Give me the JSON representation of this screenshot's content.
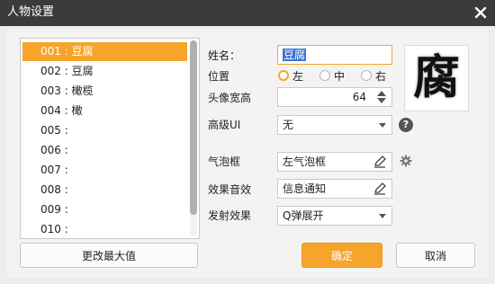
{
  "window": {
    "title": "人物设置"
  },
  "character_list": {
    "items": [
      {
        "label": "001 : 豆腐",
        "selected": true
      },
      {
        "label": "002 : 豆腐",
        "selected": false
      },
      {
        "label": "003 : 橄榄",
        "selected": false
      },
      {
        "label": "004 : 橄",
        "selected": false
      },
      {
        "label": "005 :",
        "selected": false
      },
      {
        "label": "006 :",
        "selected": false
      },
      {
        "label": "007 :",
        "selected": false
      },
      {
        "label": "008 :",
        "selected": false
      },
      {
        "label": "009 :",
        "selected": false
      },
      {
        "label": "010 :",
        "selected": false
      }
    ]
  },
  "buttons": {
    "change_max": "更改最大值",
    "ok": "确定",
    "cancel": "取消"
  },
  "form": {
    "name_label": "姓名：",
    "name_value": "豆腐",
    "position_label": "位置",
    "position_options": [
      "左",
      "中",
      "右"
    ],
    "position_selected": "左",
    "avatar_width_label": "头像宽高",
    "avatar_width_value": "64",
    "advanced_ui_label": "高级UI",
    "advanced_ui_value": "无",
    "bubble_label": "气泡框",
    "bubble_value": "左气泡框",
    "sound_label": "效果音效",
    "sound_value": "信息通知",
    "launch_label": "发射效果",
    "launch_value": "Q弹展开"
  },
  "avatar": {
    "glyph": "腐"
  },
  "help": {
    "glyph": "?"
  },
  "colors": {
    "accent": "#f6a52a",
    "titlebar": "#3b3b3b",
    "selection": "#3d74d6"
  },
  "icons": [
    "close-icon",
    "spin-up-icon",
    "spin-down-icon",
    "dropdown-arrow-icon",
    "help-icon",
    "edit-icon",
    "gear-icon"
  ]
}
